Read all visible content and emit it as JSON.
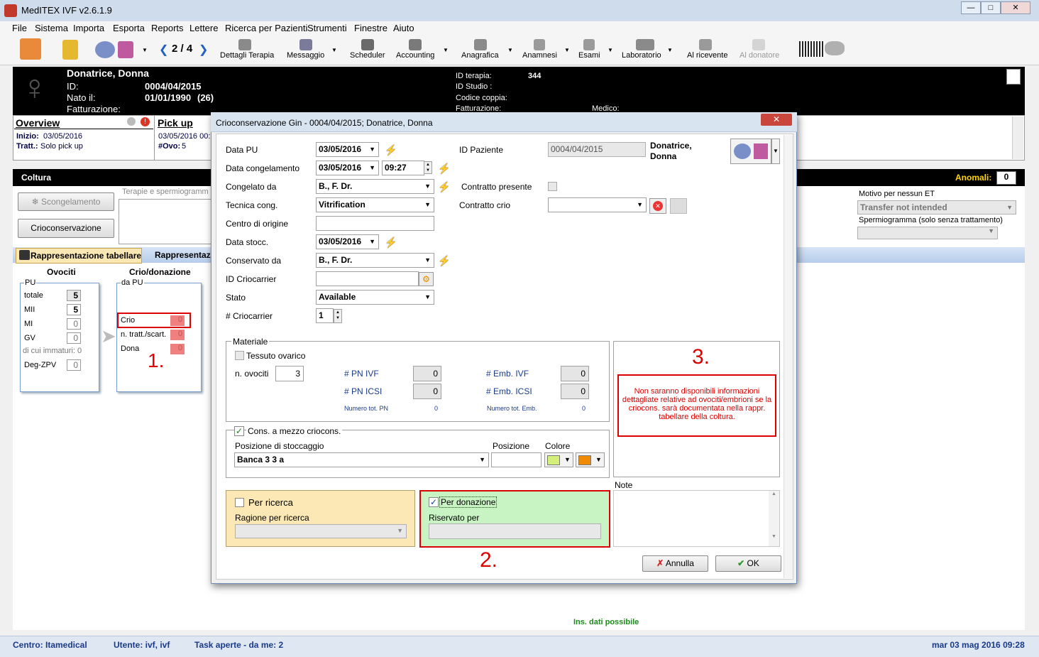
{
  "window": {
    "title": "MedITEX IVF v2.6.1.9"
  },
  "menu": [
    "File",
    "Sistema",
    "Importa",
    "Esporta",
    "Reports",
    "Lettere",
    "Ricerca per Pazienti",
    "Strumenti",
    "Finestre",
    "Aiuto"
  ],
  "toolbar": {
    "counter": "2 / 4",
    "dettagli": "Dettagli Terapia",
    "messaggio": "Messaggio",
    "scheduler": "Scheduler",
    "accounting": "Accounting",
    "anagrafica": "Anagrafica",
    "anamnesi": "Anamnesi",
    "esami": "Esami",
    "laboratorio": "Laboratorio",
    "al_ricevente": "Al ricevente",
    "al_donatore": "Al donatore"
  },
  "patient": {
    "name": "Donatrice, Donna",
    "id_label": "ID:",
    "id_value": "0004/04/2015",
    "nato_label": "Nato il:",
    "nato_value": "01/01/1990",
    "age": "(26)",
    "fatt_label": "Fatturazione:",
    "id_terapia_label": "ID terapia:",
    "id_terapia_value": "344",
    "id_studio_label": "ID Studio :",
    "codice_coppia_label": "Codice coppia:",
    "fatturazione2_label": "Fatturazione:",
    "medico_label": "Medico:"
  },
  "overview": {
    "title": "Overview",
    "inizio_label": "Inizio:",
    "inizio_value": "03/05/2016",
    "tratt_label": "Tratt.:",
    "tratt_value": "Solo pick up"
  },
  "pickup": {
    "title": "Pick up",
    "date": "03/05/2016 00:",
    "ovo_label": "#Ovo:",
    "ovo_value": "5"
  },
  "coltura": {
    "title": "Coltura",
    "anomali_label": "Anomali:",
    "anomali_value": "0",
    "scongelamento": "Scongelamento",
    "crioconservazione": "Crioconservazione",
    "terapie_label": "Terapie e spermiogramm",
    "motivo_label": "Motivo per nessun ET",
    "motivo_value": "Transfer not intended",
    "spermio_label": "Spermiogramma (solo senza trattamento)",
    "tab1": "Rappresentazione tabellare",
    "tab2": "Rappresentaz"
  },
  "ovociti": {
    "title": "Ovociti",
    "pu_label": "PU",
    "rows": [
      {
        "label": "totale",
        "value": "5"
      },
      {
        "label": "MII",
        "value": "5"
      },
      {
        "label": "MI",
        "value": "0"
      },
      {
        "label": "GV",
        "value": "0"
      }
    ],
    "immaturi": "di cui immaturi: 0",
    "deg_label": "Deg-ZPV",
    "deg_value": "0"
  },
  "crio": {
    "title": "Crio/donazione",
    "da_pu": "da PU",
    "rows": [
      {
        "label": "Crio",
        "value": "0"
      },
      {
        "label": "n. tratt./scart.",
        "value": "0"
      },
      {
        "label": "Dona",
        "value": "0"
      }
    ]
  },
  "annotations": {
    "one": "1.",
    "two": "2.",
    "three": "3."
  },
  "dialog": {
    "title": "Crioconservazione Gin  - 0004/04/2015; Donatrice, Donna",
    "data_pu_label": "Data PU",
    "data_pu": "03/05/2016",
    "data_cong_label": "Data congelamento",
    "data_cong": "03/05/2016",
    "ora_cong": "09:27",
    "congelato_label": "Congelato da",
    "congelato": "B., F. Dr.",
    "tecnica_label": "Tecnica cong.",
    "tecnica": "Vitrification",
    "centro_label": "Centro di origine",
    "data_stocc_label": "Data stocc.",
    "data_stocc": "03/05/2016",
    "conservato_label": "Conservato da",
    "conservato": "B., F. Dr.",
    "criocarrier_label": "ID Criocarrier",
    "stato_label": "Stato",
    "stato": "Available",
    "num_criocarrier_label": "# Criocarrier",
    "num_criocarrier": "1",
    "id_paziente_label": "ID Paziente",
    "id_paziente": "0004/04/2015",
    "paziente_name1": "Donatrice,",
    "paziente_name2": "Donna",
    "contratto_presente_label": "Contratto presente",
    "contratto_crio_label": "Contratto crio",
    "materiale_label": "Materiale",
    "tessuto_label": "Tessuto ovarico",
    "n_ovociti_label": "n. ovociti",
    "n_ovociti": "3",
    "pn_ivf_label": "# PN IVF",
    "pn_ivf": "0",
    "pn_icsi_label": "# PN ICSI",
    "pn_icsi": "0",
    "num_tot_pn_label": "Numero tot. PN",
    "num_tot_pn": "0",
    "emb_ivf_label": "# Emb. IVF",
    "emb_ivf": "0",
    "emb_icsi_label": "# Emb. ICSI",
    "emb_icsi": "0",
    "num_tot_emb_label": "Numero tot. Emb.",
    "num_tot_emb": "0",
    "cons_label": "Cons. a mezzo criocons.",
    "posizione_stocc_label": "Posizione di stoccaggio",
    "posizione_stocc": "Banca 3 3 a",
    "posizione_label": "Posizione",
    "colore_label": "Colore",
    "info_text": "Non saranno disponibili informazioni dettagliate relative ad ovociti/embrioni se la criocons. sarà documentata nella rappr. tabellare della coltura.",
    "per_ricerca_label": "Per ricerca",
    "ragione_label": "Ragione per ricerca",
    "per_donazione_label": "Per donazione",
    "riservato_label": "Riservato per",
    "note_label": "Note",
    "annulla": "Annulla",
    "ok": "OK"
  },
  "status": {
    "ins_dati": "Ins. dati possibile",
    "centro": "Centro: Itamedical",
    "utente": "Utente: ivf, ivf",
    "task": "Task aperte - da me: 2",
    "datetime": "mar 03 mag 2016 09:28"
  },
  "colors": {
    "yellow_swatch": "#d4f07a",
    "orange_swatch": "#f08a00",
    "per_ricerca_bg": "#fce8b4",
    "per_donazione_bg": "#c8f4c4",
    "annotation_red": "#d00000"
  }
}
